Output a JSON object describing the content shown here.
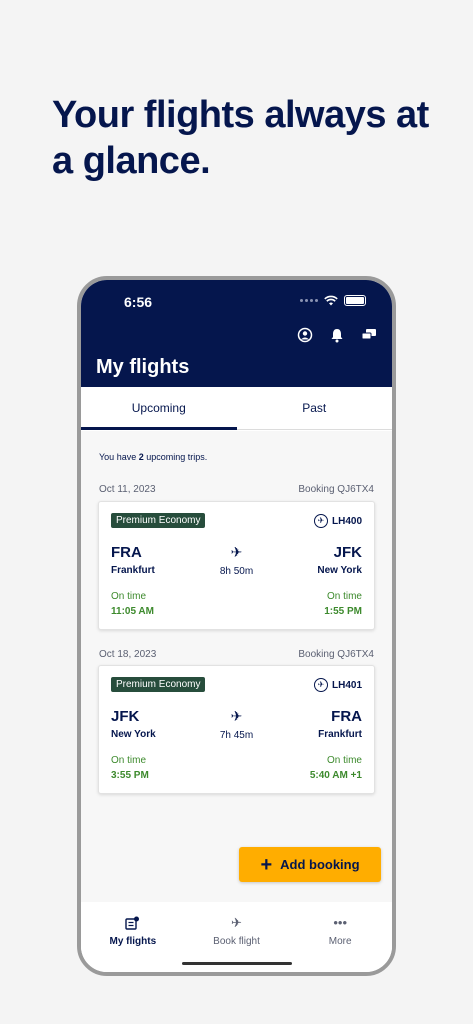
{
  "headline": "Your flights always at a glance.",
  "status_bar": {
    "time": "6:56"
  },
  "header": {
    "title": "My flights",
    "actions": [
      "profile-icon",
      "bell-icon",
      "messages-icon"
    ]
  },
  "tabs": [
    {
      "label": "Upcoming",
      "active": true
    },
    {
      "label": "Past",
      "active": false
    }
  ],
  "summary": {
    "prefix": "You have ",
    "count": "2",
    "suffix": " upcoming trips."
  },
  "trips": [
    {
      "date": "Oct 11, 2023",
      "booking": "Booking QJ6TX4",
      "cabin": "Premium Economy",
      "flight": "LH400",
      "from_code": "FRA",
      "from_city": "Frankfurt",
      "to_code": "JFK",
      "to_city": "New York",
      "duration": "8h 50m",
      "dep_status": "On time",
      "dep_time": "11:05 AM",
      "arr_status": "On time",
      "arr_time": "1:55 PM"
    },
    {
      "date": "Oct 18, 2023",
      "booking": "Booking QJ6TX4",
      "cabin": "Premium Economy",
      "flight": "LH401",
      "from_code": "JFK",
      "from_city": "New York",
      "to_code": "FRA",
      "to_city": "Frankfurt",
      "duration": "7h 45m",
      "dep_status": "On time",
      "dep_time": "3:55 PM",
      "arr_status": "On time",
      "arr_time": "5:40 AM +1"
    }
  ],
  "add_booking": "Add booking",
  "bottom_nav": [
    {
      "label": "My flights",
      "icon": "my-flights-icon",
      "active": true
    },
    {
      "label": "Book flight",
      "icon": "airplane-icon",
      "active": false
    },
    {
      "label": "More",
      "icon": "more-icon",
      "active": false
    }
  ],
  "colors": {
    "navy": "#05164d",
    "accent": "#ffad00",
    "badge": "#274d3c",
    "on_time": "#3d8a2d"
  }
}
